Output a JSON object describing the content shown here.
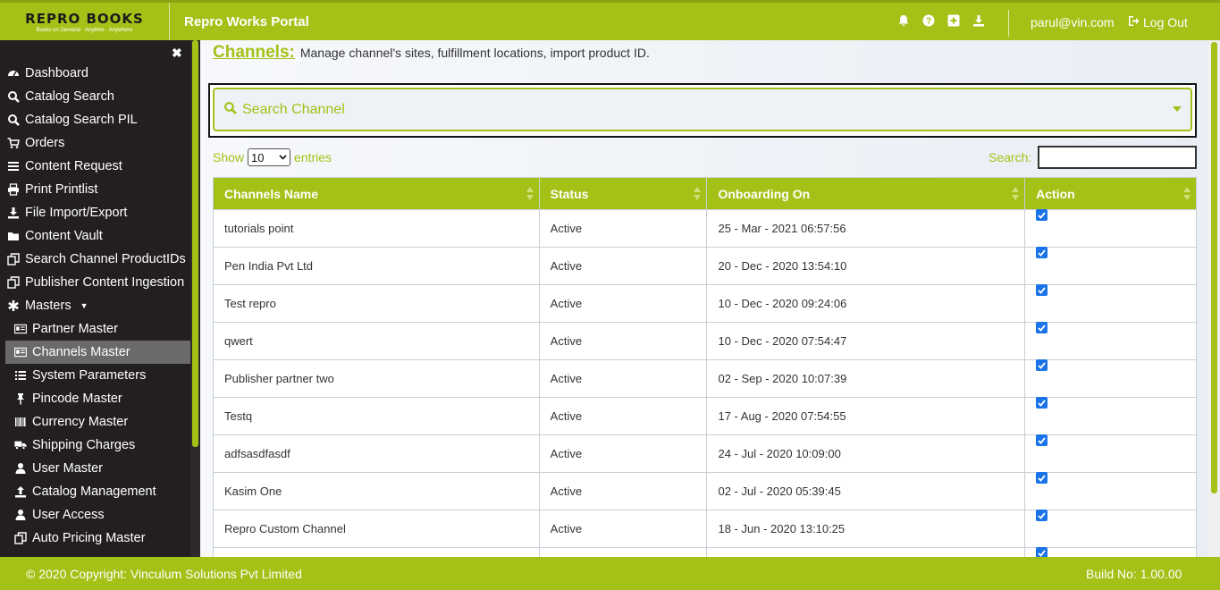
{
  "header": {
    "logo_main": "REPRO BOOKS",
    "logo_sub": "Books on Demand · Anytime · Anywhere",
    "title": "Repro Works Portal",
    "user_email": "parul@vin.com",
    "logout_label": "Log Out",
    "icons": [
      "bell-icon",
      "help-icon",
      "plus-square-icon",
      "download-icon"
    ]
  },
  "sidebar": {
    "items": [
      {
        "label": "Dashboard",
        "icon": "dashboard-icon"
      },
      {
        "label": "Catalog Search",
        "icon": "search-icon"
      },
      {
        "label": "Catalog Search PIL",
        "icon": "search-icon"
      },
      {
        "label": "Orders",
        "icon": "cart-icon"
      },
      {
        "label": "Content Request",
        "icon": "list-icon"
      },
      {
        "label": "Print Printlist",
        "icon": "print-icon"
      },
      {
        "label": "File Import/Export",
        "icon": "download-icon"
      },
      {
        "label": "Content Vault",
        "icon": "folder-icon"
      },
      {
        "label": "Search Channel ProductIDs",
        "icon": "copy-icon"
      },
      {
        "label": "Publisher Content Ingestion",
        "icon": "copy-icon"
      },
      {
        "label": "Masters",
        "icon": "asterisk-icon"
      },
      {
        "label": "Partner Master",
        "icon": "card-icon"
      },
      {
        "label": "Channels Master",
        "icon": "card-icon"
      },
      {
        "label": "System Parameters",
        "icon": "list-ul-icon"
      },
      {
        "label": "Pincode Master",
        "icon": "pin-icon"
      },
      {
        "label": "Currency Master",
        "icon": "barcode-icon"
      },
      {
        "label": "Shipping Charges",
        "icon": "truck-icon"
      },
      {
        "label": "User Master",
        "icon": "user-icon"
      },
      {
        "label": "Catalog Management",
        "icon": "upload-icon"
      },
      {
        "label": "User Access",
        "icon": "user-icon"
      },
      {
        "label": "Auto Pricing Master",
        "icon": "copy-icon"
      }
    ]
  },
  "page": {
    "title": "Channels:",
    "description": "Manage channel's sites, fulfillment locations, import product ID."
  },
  "channel_search": {
    "placeholder": "Search Channel"
  },
  "table_controls": {
    "show_label": "Show",
    "entries_value": "10",
    "entries_label": "entries",
    "search_label": "Search:"
  },
  "table": {
    "columns": [
      "Channels Name",
      "Status",
      "Onboarding On",
      "Action"
    ],
    "rows": [
      {
        "name": "tutorials point",
        "status": "Active",
        "onboarding": "25 - Mar - 2021 06:57:56",
        "action_checked": true
      },
      {
        "name": "Pen India Pvt Ltd",
        "status": "Active",
        "onboarding": "20 - Dec - 2020 13:54:10",
        "action_checked": true
      },
      {
        "name": "Test repro",
        "status": "Active",
        "onboarding": "10 - Dec - 2020 09:24:06",
        "action_checked": true
      },
      {
        "name": "qwert",
        "status": "Active",
        "onboarding": "10 - Dec - 2020 07:54:47",
        "action_checked": true
      },
      {
        "name": "Publisher partner two",
        "status": "Active",
        "onboarding": "02 - Sep - 2020 10:07:39",
        "action_checked": true
      },
      {
        "name": "Testq",
        "status": "Active",
        "onboarding": "17 - Aug - 2020 07:54:55",
        "action_checked": true
      },
      {
        "name": "adfsasdfasdf",
        "status": "Active",
        "onboarding": "24 - Jul - 2020 10:09:00",
        "action_checked": true
      },
      {
        "name": "Kasim One",
        "status": "Active",
        "onboarding": "02 - Jul - 2020 05:39:45",
        "action_checked": true
      },
      {
        "name": "Repro Custom Channel",
        "status": "Active",
        "onboarding": "18 - Jun - 2020 13:10:25",
        "action_checked": true
      }
    ]
  },
  "footer": {
    "copyright": "© 2020 Copyright: Vinculum Solutions Pvt Limited",
    "build": "Build No: 1.00.00"
  },
  "colors": {
    "accent": "#a4c117",
    "sidebar_bg": "#231f20",
    "checkbox": "#1a73e8"
  }
}
